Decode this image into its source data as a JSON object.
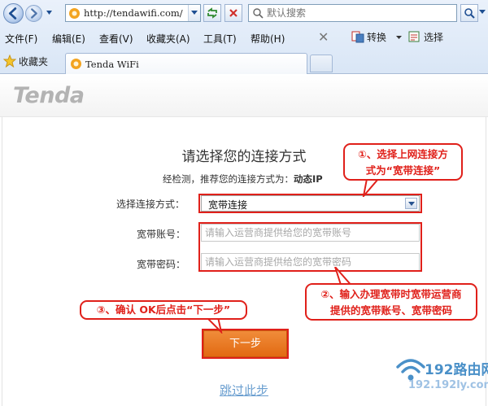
{
  "browser": {
    "url": "http://tendawifi.com/",
    "search_placeholder": "默认搜索",
    "menu": [
      "文件(F)",
      "编辑(E)",
      "查看(V)",
      "收藏夹(A)",
      "工具(T)",
      "帮助(H)"
    ],
    "convert_label": "转换",
    "select_label": "选择",
    "favorites_label": "收藏夹",
    "tab_title": "Tenda WiFi"
  },
  "page": {
    "logo": "Tenda",
    "title": "请选择您的连接方式",
    "detect_prefix": "经检测，推荐您的连接方式为：",
    "detect_value": "动态IP",
    "connection_label": "选择连接方式：",
    "connection_value": "宽带连接",
    "account_label": "宽带账号：",
    "account_placeholder": "请输入运营商提供给您的宽带账号",
    "password_label": "宽带密码：",
    "password_placeholder": "请输入运营商提供给您的宽带密码",
    "next_button": "下一步",
    "skip_link": "跳过此步"
  },
  "annotations": {
    "step1": [
      "①、选择上网连接方",
      "式为“宽带连接”"
    ],
    "step2": [
      "②、输入办理宽带时宽带运营商",
      "提供的宽带账号、宽带密码"
    ],
    "step3": "③、确认 OK后点击“下一步”",
    "accent_color": "#e0201a"
  },
  "watermark": {
    "brand": "192路由网",
    "url": "192.192ly.com"
  },
  "colors": {
    "button_orange": "#e8761f",
    "link_blue": "#6b9fd0"
  }
}
